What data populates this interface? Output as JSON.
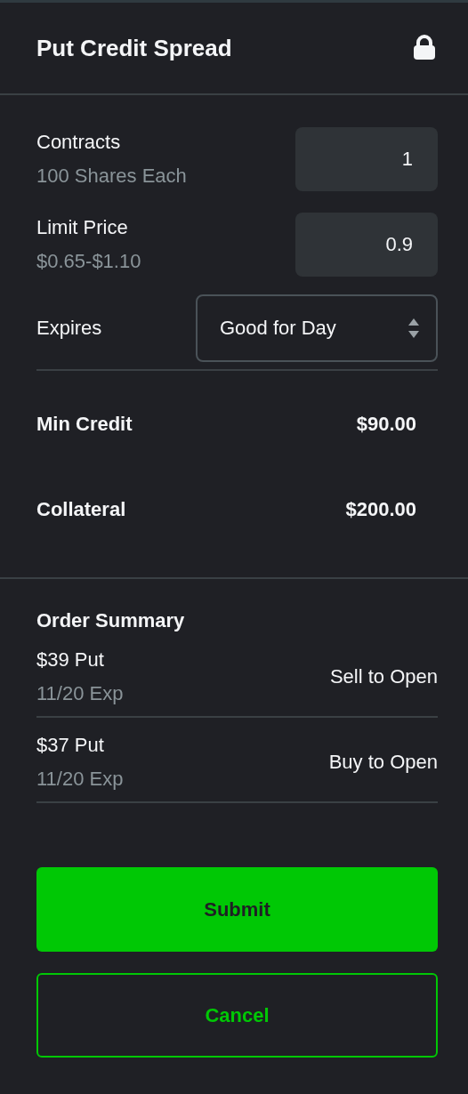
{
  "header": {
    "title": "Put Credit Spread"
  },
  "fields": [
    {
      "kind": "input",
      "label": "Contracts",
      "hint": "100 Shares Each",
      "value": "1"
    },
    {
      "kind": "input",
      "label": "Limit Price",
      "hint": "$0.65-$1.10",
      "value": "0.9"
    },
    {
      "kind": "select",
      "label": "Expires",
      "value": "Good for Day"
    }
  ],
  "totals": [
    {
      "label": "Min Credit",
      "value": "$90.00"
    },
    {
      "label": "Collateral",
      "value": "$200.00"
    }
  ],
  "order_summary": {
    "title": "Order Summary",
    "legs": [
      {
        "option": "$39 Put",
        "expiry": "11/20 Exp",
        "action": "Sell to Open"
      },
      {
        "option": "$37 Put",
        "expiry": "11/20 Exp",
        "action": "Buy to Open"
      }
    ]
  },
  "buttons": [
    {
      "kind": "primary",
      "label": "Submit"
    },
    {
      "kind": "secondary",
      "label": "Cancel"
    }
  ]
}
